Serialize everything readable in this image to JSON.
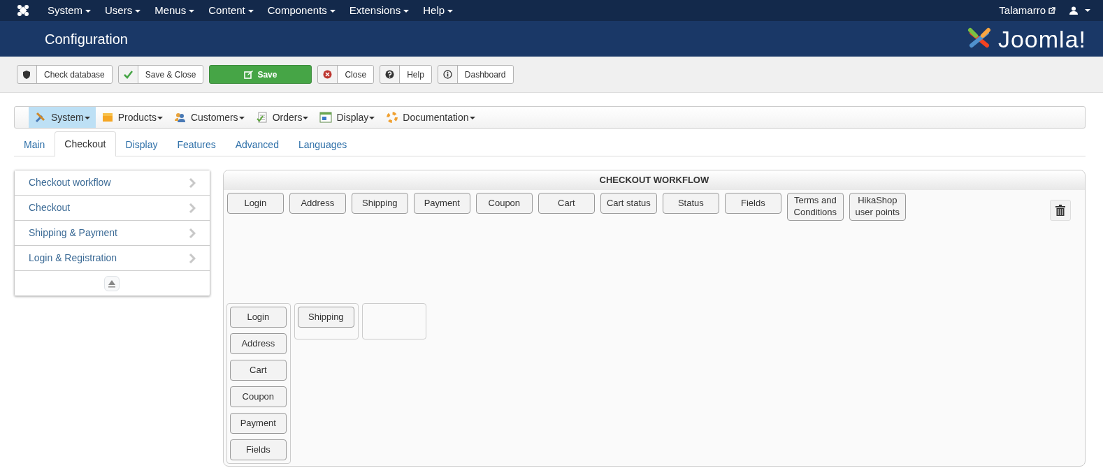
{
  "topbar": {
    "menus": [
      "System",
      "Users",
      "Menus",
      "Content",
      "Components",
      "Extensions",
      "Help"
    ],
    "user_link": "Talamarro"
  },
  "header": {
    "title": "Configuration",
    "logo_text": "Joomla!"
  },
  "toolbar": [
    {
      "kind": "shield",
      "label": "Check database"
    },
    {
      "kind": "check",
      "label": "Save & Close"
    },
    {
      "kind": "save",
      "label": "Save"
    },
    {
      "kind": "close",
      "label": "Close"
    },
    {
      "kind": "help",
      "label": "Help"
    },
    {
      "kind": "info",
      "label": "Dashboard"
    }
  ],
  "submenu": [
    {
      "kind": "tools",
      "label": "System",
      "selected": true
    },
    {
      "kind": "box",
      "label": "Products",
      "selected": false
    },
    {
      "kind": "people",
      "label": "Customers",
      "selected": false
    },
    {
      "kind": "doc",
      "label": "Orders",
      "selected": false
    },
    {
      "kind": "window",
      "label": "Display",
      "selected": false
    },
    {
      "kind": "lifebuoy",
      "label": "Documentation",
      "selected": false
    }
  ],
  "tabs": [
    {
      "label": "Main",
      "selected": false
    },
    {
      "label": "Checkout",
      "selected": true
    },
    {
      "label": "Display",
      "selected": false
    },
    {
      "label": "Features",
      "selected": false
    },
    {
      "label": "Advanced",
      "selected": false
    },
    {
      "label": "Languages",
      "selected": false
    }
  ],
  "sidebar": {
    "items": [
      "Checkout workflow",
      "Checkout",
      "Shipping & Payment",
      "Login & Registration"
    ]
  },
  "workflow": {
    "title": "CHECKOUT WORKFLOW",
    "palette": [
      "Login",
      "Address",
      "Shipping",
      "Payment",
      "Coupon",
      "Cart",
      "Cart status",
      "Status",
      "Fields",
      "Terms and Conditions",
      "HikaShop user points"
    ],
    "steps": [
      {
        "items": [
          "Login",
          "Address",
          "Cart",
          "Coupon",
          "Payment",
          "Fields"
        ]
      },
      {
        "items": [
          "Shipping"
        ]
      }
    ],
    "new_step_zone": true
  }
}
